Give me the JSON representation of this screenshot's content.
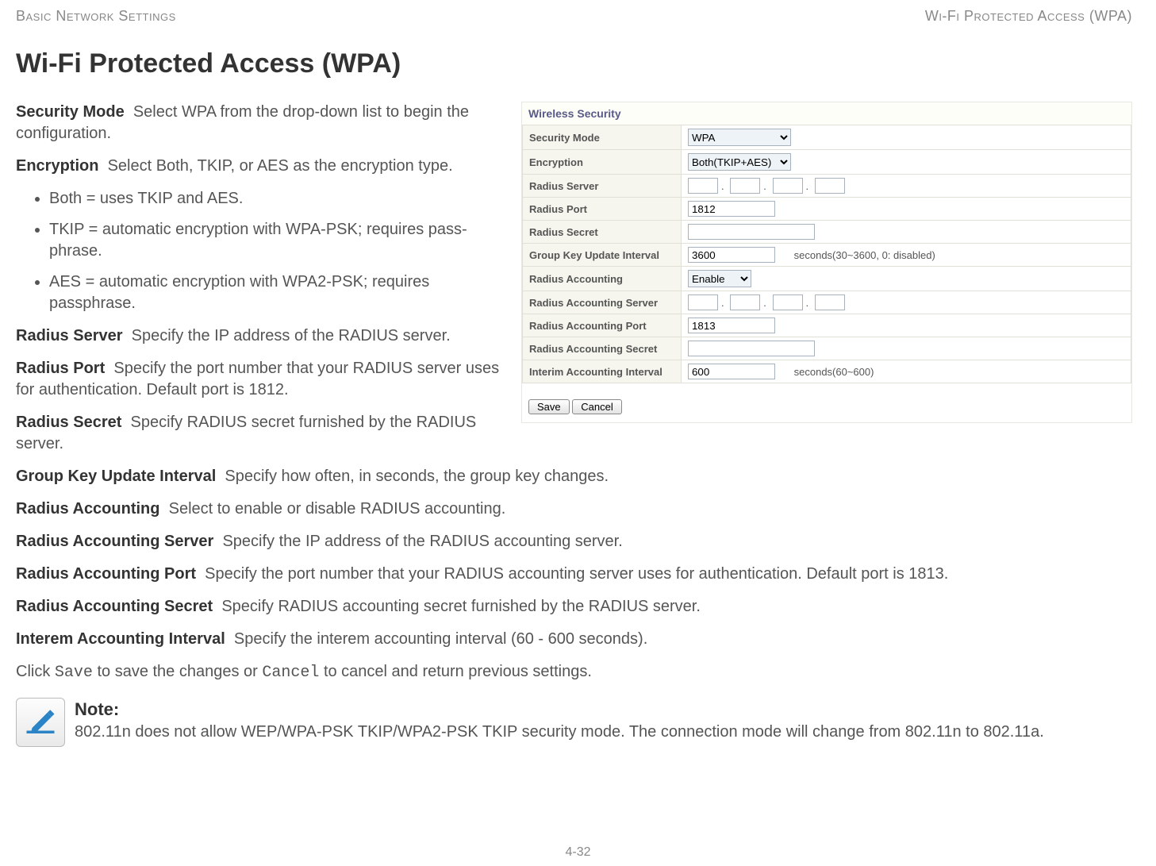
{
  "header": {
    "left": "Basic Network Settings",
    "right": "Wi-Fi Protected Access (WPA)"
  },
  "title": "Wi-Fi Protected Access (WPA)",
  "body": {
    "security_mode": {
      "label": "Security Mode",
      "text": "Select WPA from the drop-down list to begin the configuration."
    },
    "encryption": {
      "label": "Encryption",
      "text": "Select Both, TKIP, or AES as the encryption type."
    },
    "enc_bullets": [
      "Both = uses TKIP and AES.",
      "TKIP = automatic encryption with WPA-PSK; requires pass-phrase.",
      "AES = automatic encryption with WPA2-PSK; requires passphrase."
    ],
    "radius_server": {
      "label": "Radius Server",
      "text": "Specify the IP address of the RADIUS server."
    },
    "radius_port": {
      "label": "Radius Port",
      "text": "Specify the port number that your RADIUS server uses for authentication. Default port is 1812."
    },
    "radius_secret": {
      "label": "Radius Secret",
      "text": "Specify RADIUS secret furnished by the RADIUS server."
    },
    "group_key": {
      "label": "Group Key Update Interval",
      "text": "Specify how often, in seconds, the group key changes."
    },
    "radius_acc": {
      "label": "Radius Accounting",
      "text": "Select to enable or disable RADIUS accounting."
    },
    "radius_acc_server": {
      "label": "Radius Accounting Server",
      "text": "Specify the IP address of the RADIUS accounting server."
    },
    "radius_acc_port": {
      "label": "Radius Accounting Port",
      "text": "Specify the port number that your RADIUS accounting server uses for authentication. Default port is 1813."
    },
    "radius_acc_secret": {
      "label": "Radius Accounting Secret",
      "text": "Specify RADIUS accounting secret furnished by the RADIUS server."
    },
    "interem": {
      "label": "Interem Accounting Interval",
      "text": "Specify the interem accounting interval (60 - 600 seconds)."
    },
    "save_line": {
      "pre": "Click ",
      "save": "Save",
      "mid": " to save the changes or ",
      "cancel": "Cancel",
      "post": " to cancel and return previous settings."
    }
  },
  "note": {
    "title": "Note:",
    "body": "802.11n does not allow WEP/WPA-PSK TKIP/WPA2-PSK TKIP security mode. The connection mode will change from 802.11n to 802.11a."
  },
  "page_number": "4-32",
  "panel": {
    "title": "Wireless Security",
    "rows": {
      "security_mode": {
        "label": "Security Mode",
        "value": "WPA"
      },
      "encryption": {
        "label": "Encryption",
        "value": "Both(TKIP+AES)"
      },
      "radius_server": {
        "label": "Radius Server"
      },
      "radius_port": {
        "label": "Radius Port",
        "value": "1812"
      },
      "radius_secret": {
        "label": "Radius Secret"
      },
      "group_key": {
        "label": "Group Key Update Interval",
        "value": "3600",
        "hint": "seconds(30~3600, 0: disabled)"
      },
      "radius_acc": {
        "label": "Radius Accounting",
        "value": "Enable"
      },
      "radius_acc_server": {
        "label": "Radius Accounting Server"
      },
      "radius_acc_port": {
        "label": "Radius Accounting Port",
        "value": "1813"
      },
      "radius_acc_secret": {
        "label": "Radius Accounting Secret"
      },
      "interim": {
        "label": "Interim Accounting Interval",
        "value": "600",
        "hint": "seconds(60~600)"
      }
    },
    "buttons": {
      "save": "Save",
      "cancel": "Cancel"
    }
  }
}
